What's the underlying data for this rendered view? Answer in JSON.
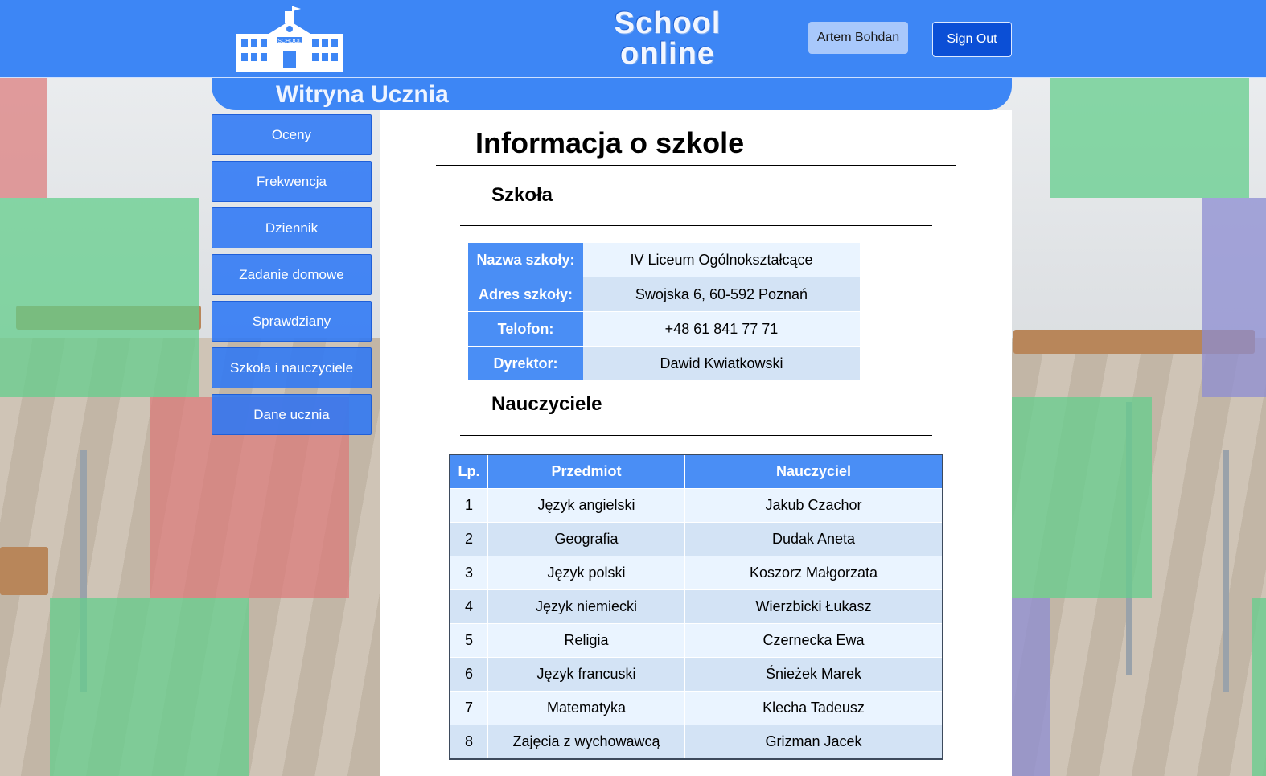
{
  "header": {
    "brand_line1": "School",
    "brand_line2": "online",
    "logo_sign": "SCHOOL",
    "user_name": "Artem Bohdan",
    "sign_out": "Sign Out"
  },
  "subheader": {
    "title": "Witryna Ucznia"
  },
  "sidebar": {
    "items": [
      {
        "label": "Oceny"
      },
      {
        "label": "Frekwencja"
      },
      {
        "label": "Dziennik"
      },
      {
        "label": "Zadanie domowe"
      },
      {
        "label": "Sprawdziany"
      },
      {
        "label": "Szkoła i nauczyciele"
      },
      {
        "label": "Dane ucznia"
      }
    ]
  },
  "main": {
    "title": "Informacja o szkole",
    "school_section": "Szkoła",
    "school_info": [
      {
        "label": "Nazwa szkoły:",
        "value": "IV Liceum Ogólnokształcące"
      },
      {
        "label": "Adres szkoły:",
        "value": "Swojska 6, 60-592 Poznań"
      },
      {
        "label": "Telofon:",
        "value": "+48 61 841 77 71"
      },
      {
        "label": "Dyrektor:",
        "value": "Dawid Kwiatkowski"
      }
    ],
    "teachers_section": "Nauczyciele",
    "teachers_headers": {
      "lp": "Lp.",
      "subject": "Przedmiot",
      "teacher": "Nauczyciel"
    },
    "teachers": [
      {
        "lp": "1",
        "subject": "Język angielski",
        "teacher": "Jakub Czachor"
      },
      {
        "lp": "2",
        "subject": "Geografia",
        "teacher": "Dudak Aneta"
      },
      {
        "lp": "3",
        "subject": "Język polski",
        "teacher": "Koszorz Małgorzata"
      },
      {
        "lp": "4",
        "subject": "Język niemiecki",
        "teacher": "Wierzbicki Łukasz"
      },
      {
        "lp": "5",
        "subject": "Religia",
        "teacher": "Czernecka Ewa"
      },
      {
        "lp": "6",
        "subject": "Język francuski",
        "teacher": "Śnieżek Marek"
      },
      {
        "lp": "7",
        "subject": "Matematyka",
        "teacher": "Klecha Tadeusz"
      },
      {
        "lp": "8",
        "subject": "Zajęcia z wychowawcą",
        "teacher": "Grizman Jacek"
      }
    ]
  },
  "colors": {
    "primary": "#3d86f5",
    "sign_out": "#0b4fd6",
    "user_button": "#a8c8fb"
  }
}
